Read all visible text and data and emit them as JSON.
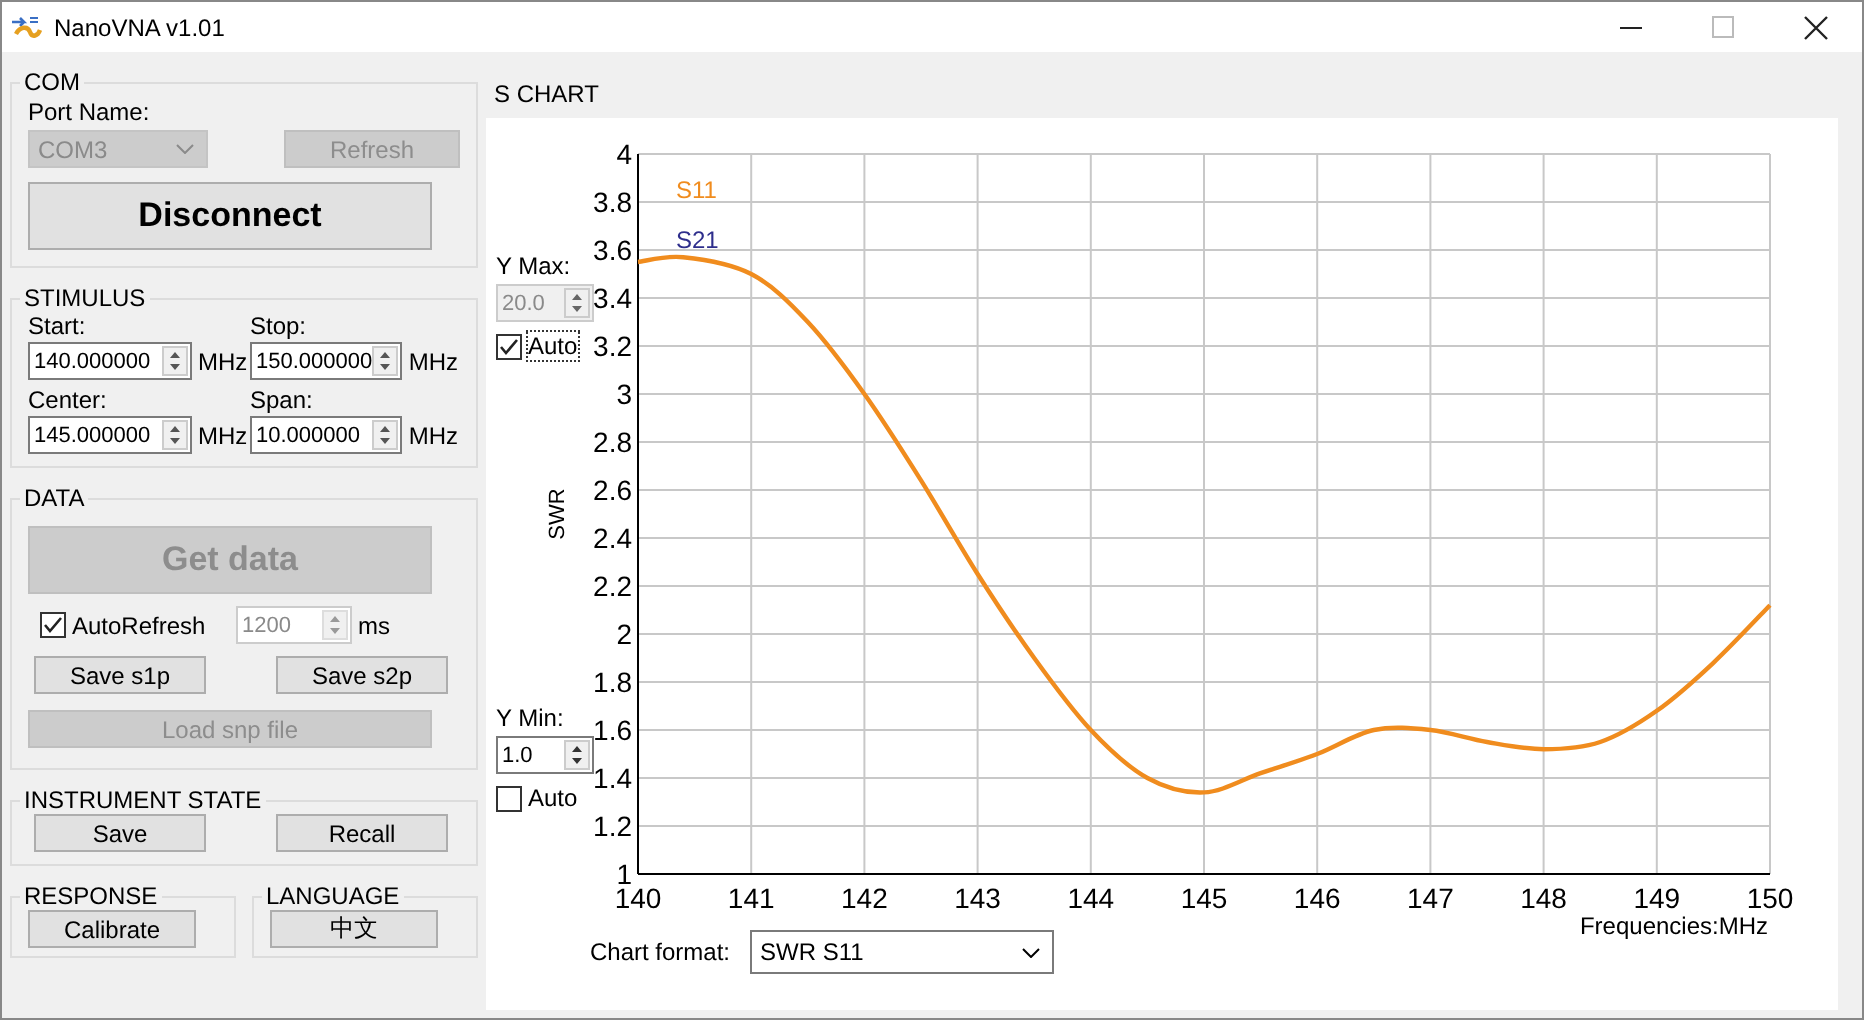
{
  "window": {
    "title": "NanoVNA v1.01"
  },
  "com": {
    "title": "COM",
    "port_label": "Port Name:",
    "port": {
      "value": "COM3",
      "disabled": true
    },
    "refresh": {
      "label": "Refresh",
      "disabled": true
    },
    "connect": {
      "label": "Disconnect",
      "disabled": false
    }
  },
  "stimulus": {
    "title": "STIMULUS",
    "fields": [
      {
        "label": "Start:",
        "value": "140.000000",
        "unit": "MHz"
      },
      {
        "label": "Stop:",
        "value": "150.000000",
        "unit": "MHz"
      },
      {
        "label": "Center:",
        "value": "145.000000",
        "unit": "MHz"
      },
      {
        "label": "Span:",
        "value": "10.000000",
        "unit": "MHz"
      }
    ]
  },
  "data": {
    "title": "DATA",
    "get_data": {
      "label": "Get data",
      "disabled": true
    },
    "auto_refresh": {
      "label": "AutoRefresh",
      "checked": true
    },
    "interval": {
      "value": "1200",
      "unit": "ms",
      "disabled": true
    },
    "save_buttons": [
      {
        "label": "Save s1p",
        "disabled": false
      },
      {
        "label": "Save s2p",
        "disabled": false
      }
    ],
    "load": {
      "label": "Load snp file",
      "disabled": true
    }
  },
  "instrument_state": {
    "title": "INSTRUMENT STATE",
    "buttons": [
      {
        "label": "Save",
        "disabled": false
      },
      {
        "label": "Recall",
        "disabled": false
      }
    ]
  },
  "response": {
    "title": "RESPONSE",
    "button": {
      "label": "Calibrate",
      "disabled": false
    }
  },
  "language": {
    "title": "LANGUAGE",
    "button": {
      "label": "中文",
      "disabled": false
    }
  },
  "s_chart": {
    "title": "S CHART",
    "y_max": {
      "label": "Y Max:",
      "value": "20.0",
      "disabled": true
    },
    "y_max_auto": {
      "label": "Auto",
      "checked": true
    },
    "y_min": {
      "label": "Y Min:",
      "value": "1.0",
      "disabled": false
    },
    "y_min_auto": {
      "label": "Auto",
      "checked": false
    },
    "chart_data": {
      "type": "line",
      "grid": true,
      "ylabel": "SWR",
      "x": [
        140,
        140.4,
        141,
        141.5,
        142,
        142.5,
        143,
        143.5,
        144,
        144.5,
        145,
        145.5,
        146,
        146.5,
        147,
        147.5,
        148,
        148.5,
        149,
        149.5,
        150
      ],
      "series": [
        {
          "name": "S11",
          "color": "#f08c1e",
          "values": [
            3.55,
            3.57,
            3.5,
            3.3,
            3.0,
            2.64,
            2.25,
            1.9,
            1.6,
            1.4,
            1.34,
            1.42,
            1.5,
            1.6,
            1.6,
            1.55,
            1.52,
            1.55,
            1.68,
            1.88,
            2.12
          ]
        },
        {
          "name": "S21",
          "color": "#2e2e8c",
          "values": [
            null,
            null,
            null,
            null,
            null,
            null,
            null,
            null,
            null,
            null,
            null,
            null,
            null,
            null,
            null,
            null,
            null,
            null,
            null,
            null,
            null
          ]
        }
      ],
      "xlim": [
        140,
        150
      ],
      "ylim": [
        1,
        4
      ],
      "xticks": [
        140,
        141,
        142,
        143,
        144,
        145,
        146,
        147,
        148,
        149,
        150
      ],
      "yticks": [
        1,
        {
          "value": 1.2,
          "label": "1.2"
        },
        {
          "value": 1.4,
          "label": "1.4"
        },
        {
          "value": 1.6,
          "label": "1.6"
        },
        {
          "value": 1.8,
          "label": "1.8"
        },
        2,
        {
          "value": 2.2,
          "label": "2.2"
        },
        {
          "value": 2.4,
          "label": "2.4"
        },
        {
          "value": 2.6,
          "label": "2.6"
        },
        {
          "value": 2.8,
          "label": "2.8"
        },
        3,
        {
          "value": 3.2,
          "label": "3.2"
        },
        {
          "value": 3.4,
          "label": "3.4"
        },
        {
          "value": 3.6,
          "label": "3.6"
        },
        {
          "value": 3.8,
          "label": "3.8"
        },
        4
      ]
    },
    "x_unit": "Frequencies:MHz",
    "chart_format": {
      "label": "Chart format:",
      "value": "SWR S11"
    }
  }
}
